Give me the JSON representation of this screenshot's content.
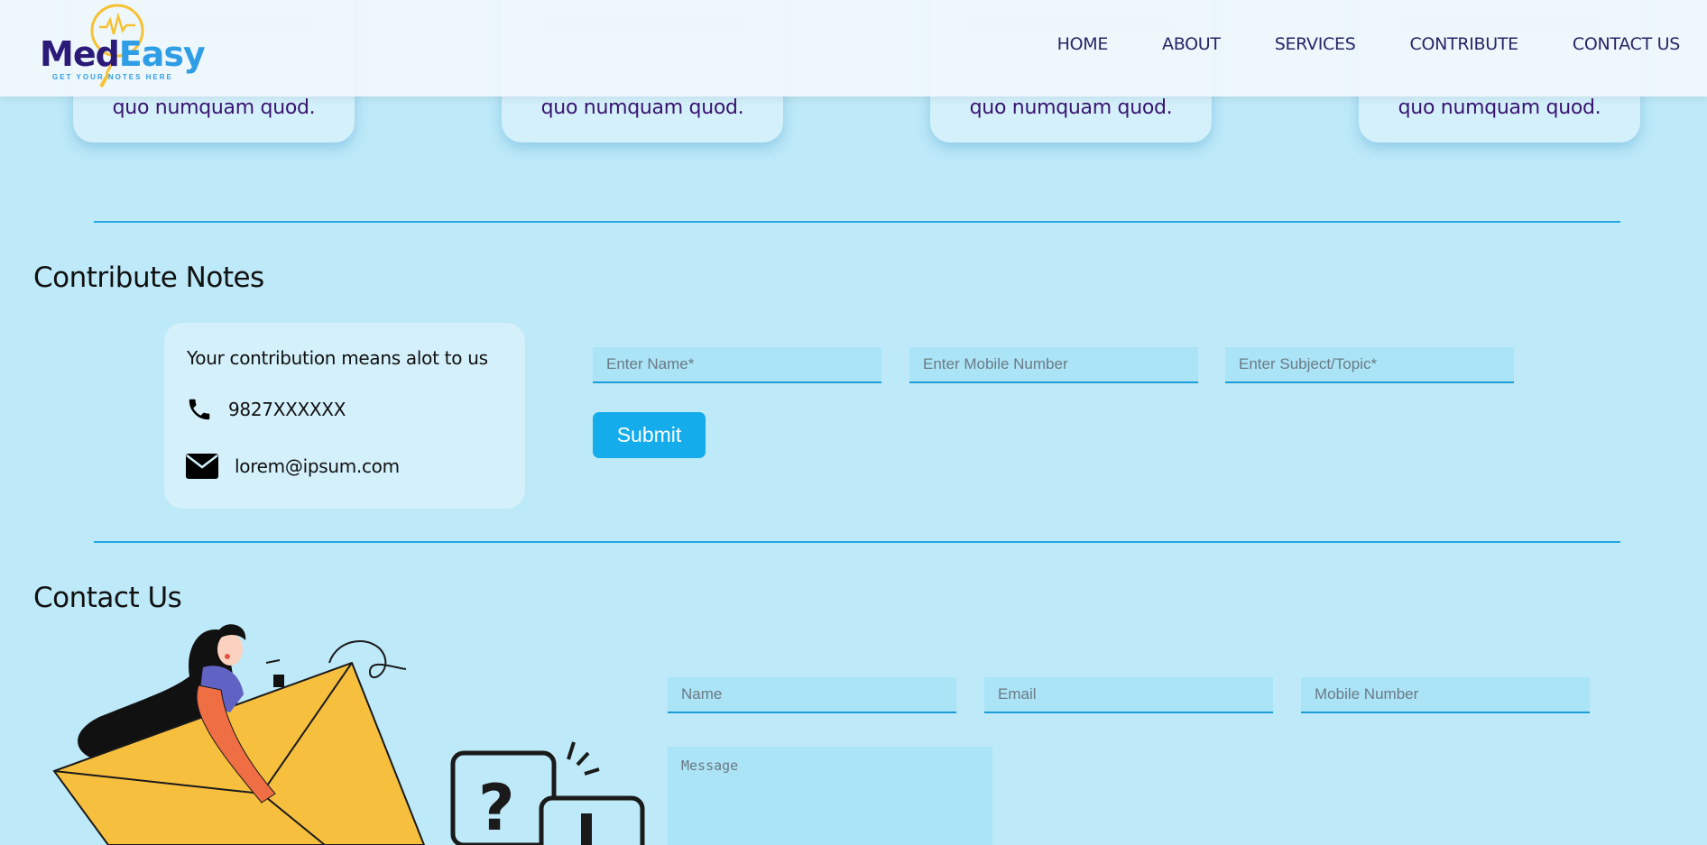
{
  "header": {
    "logo": {
      "word_part1": "Med",
      "word_part2": "Easy",
      "tagline": "GET YOUR NOTES HERE"
    },
    "nav": [
      "HOME",
      "ABOUT",
      "SERVICES",
      "CONTRIBUTE",
      "CONTACT US"
    ]
  },
  "cards": [
    {
      "text": "quo numquam quod."
    },
    {
      "text": "quo numquam quod."
    },
    {
      "text": "quo numquam quod."
    },
    {
      "text": "quo numquam quod."
    }
  ],
  "contribute": {
    "heading": "Contribute Notes",
    "info_title": "Your contribution means alot to us",
    "phone": "9827XXXXXX",
    "email": "lorem@ipsum.com",
    "name_placeholder": "Enter Name*",
    "mobile_placeholder": "Enter Mobile Number",
    "subject_placeholder": "Enter Subject/Topic*",
    "submit_label": "Submit"
  },
  "contact": {
    "heading": "Contact Us",
    "name_placeholder": "Name",
    "email_placeholder": "Email",
    "mobile_placeholder": "Mobile Number",
    "message_placeholder": "Message"
  },
  "colors": {
    "background": "#bde9f8",
    "accent": "#14aceb",
    "brand_dark": "#2b1a78",
    "brand_light": "#2f9ee6"
  }
}
